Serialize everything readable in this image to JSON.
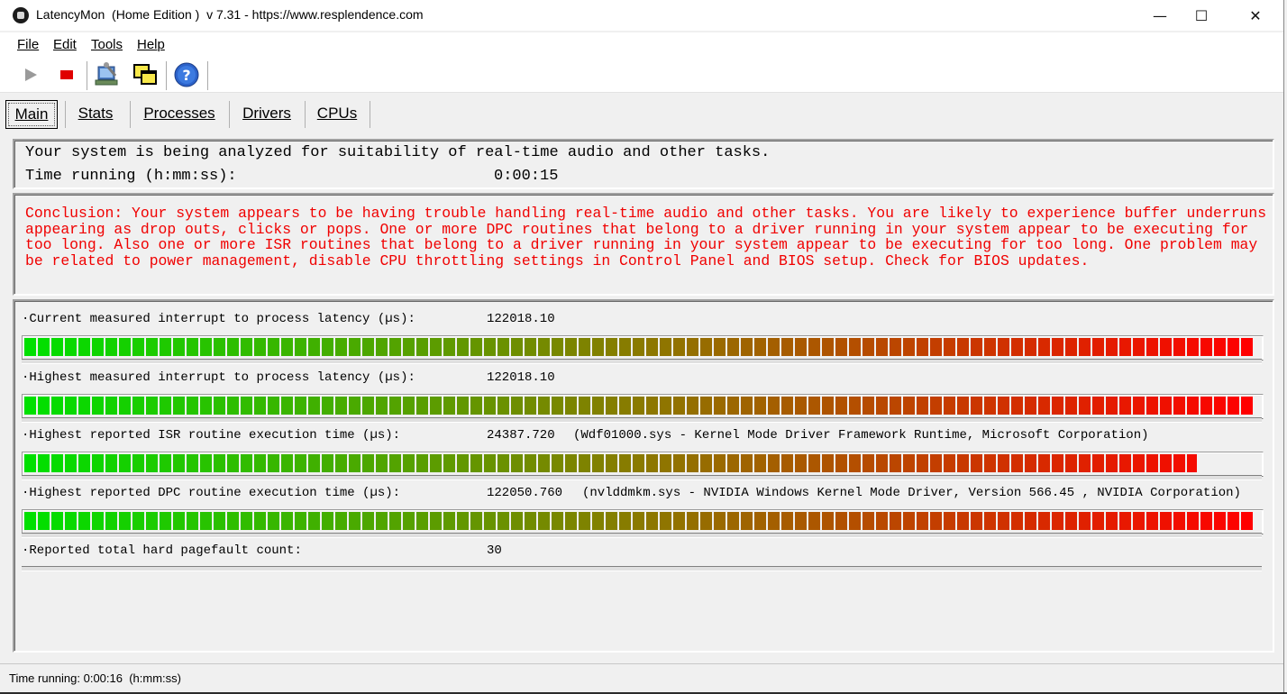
{
  "window": {
    "title": "LatencyMon  (Home Edition )  v 7.31 - https://www.resplendence.com",
    "minimize": "—",
    "maximize": "☐",
    "close": "✕"
  },
  "menu": [
    "File",
    "Edit",
    "Tools",
    "Help"
  ],
  "toolbar": {
    "buttons": [
      "play",
      "stop",
      "analyze",
      "windows",
      "help"
    ]
  },
  "tabs": [
    {
      "label": "Main",
      "active": true
    },
    {
      "label": "Stats"
    },
    {
      "label": "Processes"
    },
    {
      "label": "Drivers"
    },
    {
      "label": "CPUs"
    }
  ],
  "status_panel": {
    "line1": "Your system is being analyzed for suitability of real-time audio and other tasks.",
    "time_label": "Time running (h:mm:ss):",
    "time_value": "0:00:15"
  },
  "conclusion": "Conclusion: Your system appears to be having trouble handling real-time audio and other tasks. You are likely to experience buffer underruns appearing as drop outs, clicks or pops. One or more DPC routines that belong to a driver running in your system appear to be executing for too long. Also one or more ISR routines that belong to a driver running in your system appear to be executing for too long. One problem may be related to power management, disable CPU throttling settings in Control Panel and BIOS setup. Check for BIOS updates.",
  "metrics": [
    {
      "label": "·Current measured interrupt to process latency (µs):",
      "value": "122018.10",
      "driver": "",
      "level": 1.0
    },
    {
      "label": "·Highest measured interrupt to process latency (µs):",
      "value": "122018.10",
      "driver": "",
      "level": 1.0
    },
    {
      "label": "·Highest reported ISR routine execution time (µs):",
      "value": "24387.720",
      "driver": "(Wdf01000.sys - Kernel Mode Driver Framework Runtime, Microsoft Corporation)",
      "level": 0.948
    },
    {
      "label": "·Highest reported DPC routine execution time (µs):",
      "value": "122050.760",
      "driver": "(nvlddmkm.sys - NVIDIA Windows Kernel Mode Driver, Version 566.45 , NVIDIA Corporation)",
      "level": 1.0
    },
    {
      "label": "·Reported total hard pagefault count:",
      "value": "30",
      "driver": "",
      "level": 0
    }
  ],
  "statusbar": {
    "text": "Time running: 0:00:16  (h:mm:ss)"
  },
  "colors": {
    "conclusion_text": "#f00000",
    "bar_start": "#00e000",
    "bar_mid": "#8a7a00",
    "bar_end": "#ff0000"
  }
}
